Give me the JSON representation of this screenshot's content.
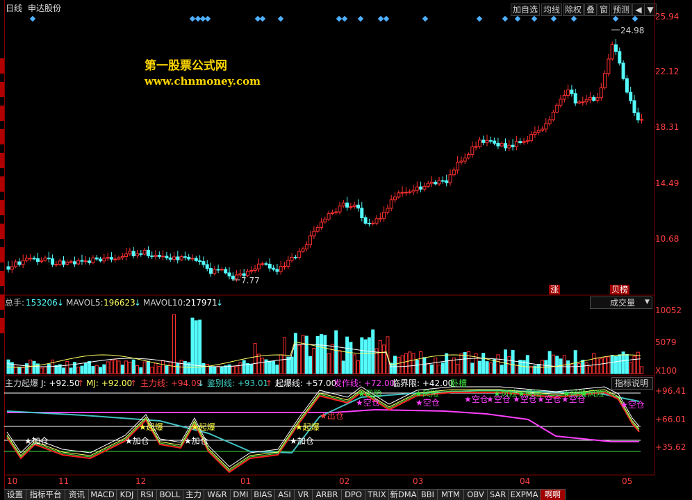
{
  "header": {
    "period": "日线",
    "stock": "申达股份"
  },
  "toolbar": {
    "add": "加自选",
    "ma": "均线",
    "exright": "除权",
    "overlay": "叠",
    "window": "窗",
    "forecast": "预测"
  },
  "watermark": {
    "line1": "第一股票公式网",
    "line2": "www.chnmoney.com"
  },
  "price_axis": [
    "25.94",
    "22.12",
    "18.31",
    "14.49",
    "10.68"
  ],
  "annot": {
    "high": "24.98",
    "low": "7.77",
    "zhang": "涨",
    "beibang": "贝榜"
  },
  "volume": {
    "total_label": "总手:",
    "total": "153206",
    "mav5_label": "MAVOL5:",
    "mav5": "196623",
    "mav10_label": "MAVOL10:",
    "mav10": "217971",
    "axis": [
      "10052",
      "5079",
      "X100"
    ],
    "dropdown": "成交量"
  },
  "indicator": {
    "name": "主力起爆",
    "j": "J: +92.50",
    "mj": "MJ: +92.00",
    "zhuli": "主力线: +94.09",
    "jianbie": "鉴别线: +93.01",
    "qibao": "起爆线: +57.00",
    "fazuo": "发作线: +72.00",
    "linjie": "临界限: +42.00",
    "tail": "卧槽",
    "axis": [
      "+96.41",
      "+66.01",
      "+35.62"
    ],
    "explain": "指标说明"
  },
  "labels": {
    "jiacang": "加仓",
    "qibao": "起爆",
    "fengxian": "风险",
    "kongcang": "空仓",
    "chucang": "出仓"
  },
  "xaxis": [
    "10",
    "11",
    "12",
    "01",
    "02",
    "03",
    "04",
    "05"
  ],
  "tabs": [
    "设置",
    "指标平台",
    "资讯",
    "MACD",
    "KDJ",
    "RSI",
    "BOLL",
    "主力",
    "W&R",
    "DMI",
    "BIAS",
    "ASI",
    "VR",
    "ARBR",
    "DPO",
    "TRIX",
    "新DMA",
    "BBI",
    "MTM",
    "OBV",
    "SAR",
    "EXPMA",
    "啊啊"
  ],
  "colors": {
    "up": "#ff3030",
    "down": "#54fcfc",
    "bg": "#000000"
  }
}
